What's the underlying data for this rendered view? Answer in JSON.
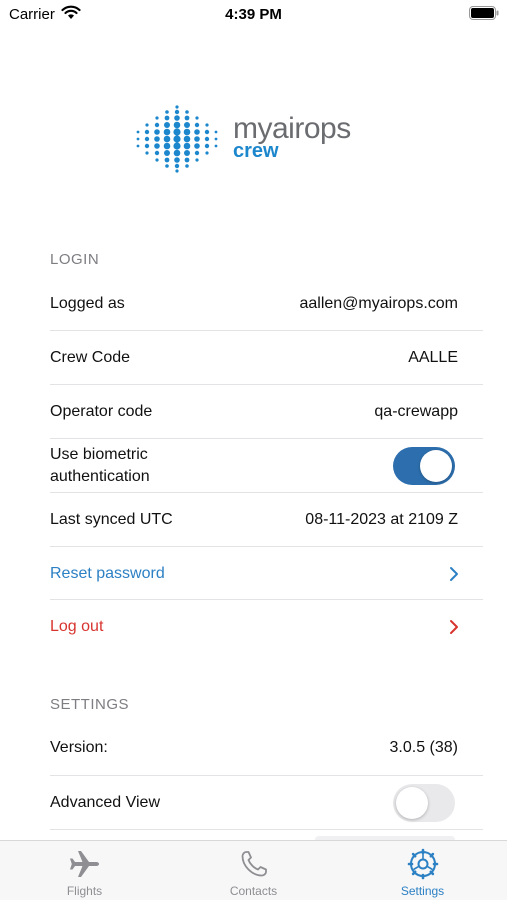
{
  "status_bar": {
    "carrier": "Carrier",
    "time": "4:39 PM"
  },
  "logo": {
    "brand": "myairops",
    "sub": "crew",
    "colors": {
      "brand": "#6a6c70",
      "accent": "#1c87cc"
    }
  },
  "login": {
    "header": "LOGIN",
    "logged_as_label": "Logged as",
    "logged_as_value": "aallen@myairops.com",
    "crew_code_label": "Crew Code",
    "crew_code_value": "AALLE",
    "operator_code_label": "Operator code",
    "operator_code_value": "qa-crewapp",
    "biometric_label_line1": "Use biometric",
    "biometric_label_line2": "authentication",
    "biometric_enabled": true,
    "last_synced_label": "Last synced UTC",
    "last_synced_value": "08-11-2023 at 2109 Z",
    "reset_password_label": "Reset password",
    "log_out_label": "Log out"
  },
  "settings": {
    "header": "SETTINGS",
    "version_label": "Version:",
    "version_value": "3.0.5 (38)",
    "advanced_view_label": "Advanced View",
    "advanced_view_enabled": false
  },
  "tab_bar": {
    "tabs": [
      {
        "label": "Flights",
        "icon": "airplane-icon",
        "active": false
      },
      {
        "label": "Contacts",
        "icon": "phone-icon",
        "active": false
      },
      {
        "label": "Settings",
        "icon": "gear-icon",
        "active": true
      }
    ]
  },
  "colors": {
    "link_blue": "#2c80c4",
    "destructive_red": "#d8342f",
    "toggle_on": "#2d6fae",
    "section_header": "#7d7d82"
  }
}
